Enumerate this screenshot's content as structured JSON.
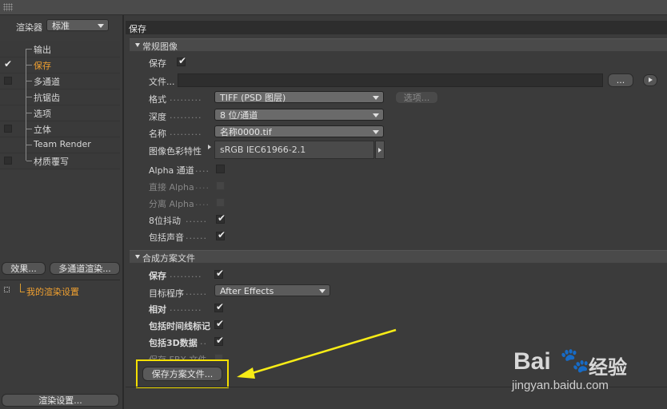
{
  "renderer": {
    "label": "渲染器",
    "value": "标准"
  },
  "tree": [
    {
      "label": "输出",
      "checkbox": false,
      "checked": false,
      "active": false
    },
    {
      "label": "保存",
      "checkbox": true,
      "checked": true,
      "active": true
    },
    {
      "label": "多通道",
      "checkbox": true,
      "checked": false,
      "active": false
    },
    {
      "label": "抗锯齿",
      "checkbox": false,
      "checked": false,
      "active": false
    },
    {
      "label": "选项",
      "checkbox": false,
      "checked": false,
      "active": false
    },
    {
      "label": "立体",
      "checkbox": true,
      "checked": false,
      "active": false
    },
    {
      "label": "Team Render",
      "checkbox": false,
      "checked": false,
      "active": false
    },
    {
      "label": "材质覆写",
      "checkbox": true,
      "checked": false,
      "active": false
    }
  ],
  "left_buttons": {
    "effects": "效果...",
    "multipass": "多通道渲染..."
  },
  "render_settings_item": "我的渲染设置",
  "render_settings_button": "渲染设置...",
  "panel_title": "保存",
  "regular_image": {
    "header": "常规图像",
    "save_label": "保存",
    "file_label": "文件...",
    "file_value": "",
    "browse_button": "...",
    "format_label": "格式",
    "format_value": "TIFF (PSD 图层)",
    "options_button": "选项...",
    "depth_label": "深度",
    "depth_value": "8 位/通道",
    "name_label": "名称",
    "name_value": "名称0000.tif",
    "color_profile_label": "图像色彩特性",
    "color_profile_value": "sRGB IEC61966-2.1",
    "alpha_label": "Alpha 通道",
    "straight_alpha_label": "直接 Alpha",
    "separate_alpha_label": "分离 Alpha",
    "dither_label": "8位抖动",
    "include_sound_label": "包括声音"
  },
  "compositing": {
    "header": "合成方案文件",
    "save_label": "保存",
    "target_label": "目标程序",
    "target_value": "After Effects",
    "relative_label": "相对",
    "timeline_markers_label": "包括时间线标记",
    "include_3d_label": "包括3D数据",
    "fbx_label": "保存 FBX 文件",
    "save_project_button": "保存方案文件..."
  },
  "watermark": {
    "brand": "Bai",
    "brand_suffix": "经验",
    "url": "jingyan.baidu.com"
  },
  "colors": {
    "active": "#f0a030",
    "highlight_box": "#f5e000",
    "arrow": "#f7ec16"
  }
}
